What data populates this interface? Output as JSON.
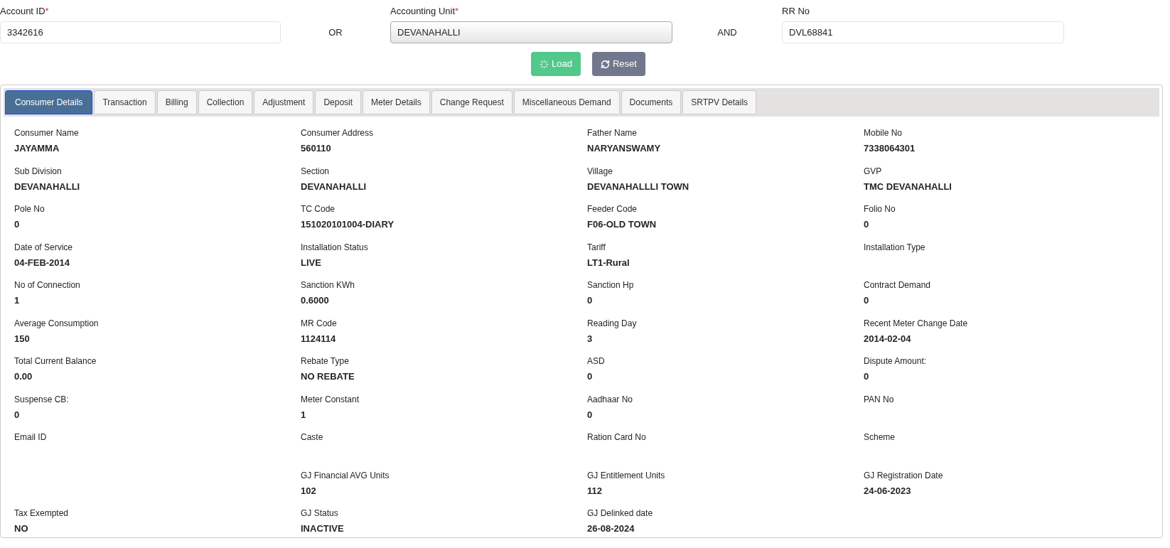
{
  "search": {
    "account_id": {
      "label": "Account ID",
      "required_mark": "*",
      "value": "3342616"
    },
    "or_text": "OR",
    "accounting_unit": {
      "label": "Accounting Unit",
      "required_mark": "*",
      "value": "DEVANAHALLI"
    },
    "and_text": "AND",
    "rr_no": {
      "label": "RR No",
      "value": "DVL68841"
    }
  },
  "buttons": [
    {
      "kind": "load",
      "label": "Load"
    },
    {
      "kind": "reset",
      "label": "Reset"
    }
  ],
  "tabs": [
    {
      "label": "Consumer Details",
      "selected": true
    },
    {
      "label": "Transaction",
      "selected": false
    },
    {
      "label": "Billing",
      "selected": false
    },
    {
      "label": "Collection",
      "selected": false
    },
    {
      "label": "Adjustment",
      "selected": false
    },
    {
      "label": "Deposit",
      "selected": false
    },
    {
      "label": "Meter Details",
      "selected": false
    },
    {
      "label": "Change Request",
      "selected": false
    },
    {
      "label": "Miscellaneous Demand",
      "selected": false
    },
    {
      "label": "Documents",
      "selected": false
    },
    {
      "label": "SRTPV Details",
      "selected": false
    }
  ],
  "details": [
    {
      "kind": "field",
      "label": "Consumer Name",
      "value": "JAYAMMA"
    },
    {
      "kind": "field",
      "label": "Consumer Address",
      "value": "560110"
    },
    {
      "kind": "field",
      "label": "Father Name",
      "value": "NARYANSWAMY"
    },
    {
      "kind": "field",
      "label": "Mobile No",
      "value": "7338064301"
    },
    {
      "kind": "field",
      "label": "Sub Division",
      "value": "DEVANAHALLI"
    },
    {
      "kind": "field",
      "label": "Section",
      "value": "DEVANAHALLI"
    },
    {
      "kind": "field",
      "label": "Village",
      "value": "DEVANAHALLLI TOWN"
    },
    {
      "kind": "field",
      "label": "GVP",
      "value": "TMC DEVANAHALLI"
    },
    {
      "kind": "field",
      "label": "Pole No",
      "value": "0"
    },
    {
      "kind": "field",
      "label": "TC Code",
      "value": "151020101004-DIARY"
    },
    {
      "kind": "field",
      "label": "Feeder Code",
      "value": "F06-OLD TOWN"
    },
    {
      "kind": "field",
      "label": "Folio No",
      "value": "0"
    },
    {
      "kind": "field",
      "label": "Date of Service",
      "value": "04-FEB-2014"
    },
    {
      "kind": "field",
      "label": "Installation Status",
      "value": "LIVE"
    },
    {
      "kind": "field",
      "label": "Tariff",
      "value": "LT1-Rural"
    },
    {
      "kind": "field",
      "label": "Installation Type"
    },
    {
      "kind": "field",
      "label": "No of Connection",
      "value": "1"
    },
    {
      "kind": "field",
      "label": "Sanction KWh",
      "value": "0.6000"
    },
    {
      "kind": "field",
      "label": "Sanction Hp",
      "value": "0"
    },
    {
      "kind": "field",
      "label": "Contract Demand",
      "value": "0"
    },
    {
      "kind": "field",
      "label": "Average Consumption",
      "value": "150"
    },
    {
      "kind": "field",
      "label": "MR Code",
      "value": "1124114"
    },
    {
      "kind": "field",
      "label": "Reading Day",
      "value": "3"
    },
    {
      "kind": "field",
      "label": "Recent Meter Change Date",
      "value": "2014-02-04"
    },
    {
      "kind": "field",
      "label": "Total Current Balance",
      "value": "0.00"
    },
    {
      "kind": "field",
      "label": "Rebate Type",
      "value": "NO REBATE"
    },
    {
      "kind": "field",
      "label": "ASD",
      "value": "0"
    },
    {
      "kind": "field",
      "label": "Dispute Amount:",
      "value": "0"
    },
    {
      "kind": "field",
      "label": "Suspense CB:",
      "value": "0"
    },
    {
      "kind": "field",
      "label": "Meter Constant",
      "value": "1"
    },
    {
      "kind": "field",
      "label": "Aadhaar No",
      "value": "0"
    },
    {
      "kind": "field",
      "label": "PAN No"
    },
    {
      "kind": "field",
      "label": "Email ID"
    },
    {
      "kind": "field",
      "label": "Caste"
    },
    {
      "kind": "field",
      "label": "Ration Card No"
    },
    {
      "kind": "field",
      "label": "Scheme"
    },
    {
      "kind": "blank"
    },
    {
      "kind": "field",
      "label": "GJ Financial AVG Units",
      "value": "102"
    },
    {
      "kind": "field",
      "label": "GJ Entitlement Units",
      "value": "112"
    },
    {
      "kind": "field",
      "label": "GJ Registration Date",
      "value": "24-06-2023"
    },
    {
      "kind": "field",
      "label": "Tax Exempted",
      "value": "NO"
    },
    {
      "kind": "field",
      "label": "GJ Status",
      "value": "INACTIVE"
    },
    {
      "kind": "field",
      "label": "GJ Delinked date",
      "value": "26-08-2024"
    }
  ]
}
